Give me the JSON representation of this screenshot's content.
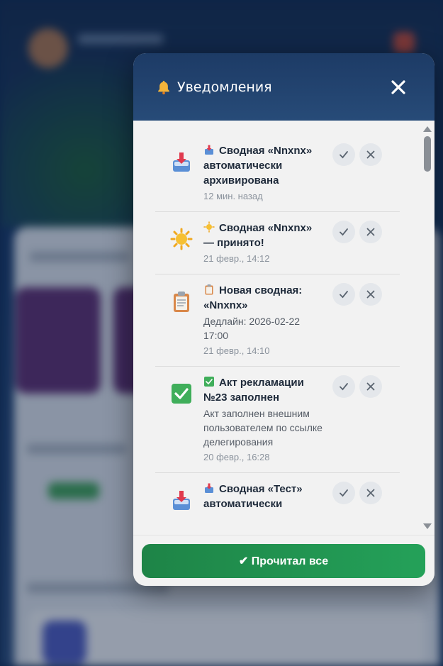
{
  "modal": {
    "title": "Уведомления",
    "read_all_label": "✔ Прочитал все"
  },
  "notifications": [
    {
      "icon": "inbox-tray-icon",
      "title": "Сводная «Nnxnx» автоматически архивирована",
      "description": "",
      "time": "12 мин. назад"
    },
    {
      "icon": "sun-icon",
      "title": "Сводная «Nnxnx» — принято!",
      "description": "",
      "time": "21 февр., 14:12"
    },
    {
      "icon": "clipboard-icon",
      "title": "Новая сводная: «Nnxnx»",
      "description": "Дедлайн: 2026-02-22 17:00",
      "time": "21 февр., 14:10"
    },
    {
      "icon": "check-box-icon",
      "title": "Акт рекламации №23 заполнен",
      "description": "Акт заполнен внешним пользователем по ссылке делегирования",
      "time": "20 февр., 16:28"
    },
    {
      "icon": "inbox-tray-icon",
      "title": "Сводная «Тест» автоматически",
      "description": "",
      "time": ""
    }
  ],
  "colors": {
    "header": "#1d3b66",
    "accent_green": "#24a159",
    "list_bg": "#f2f2f2"
  }
}
